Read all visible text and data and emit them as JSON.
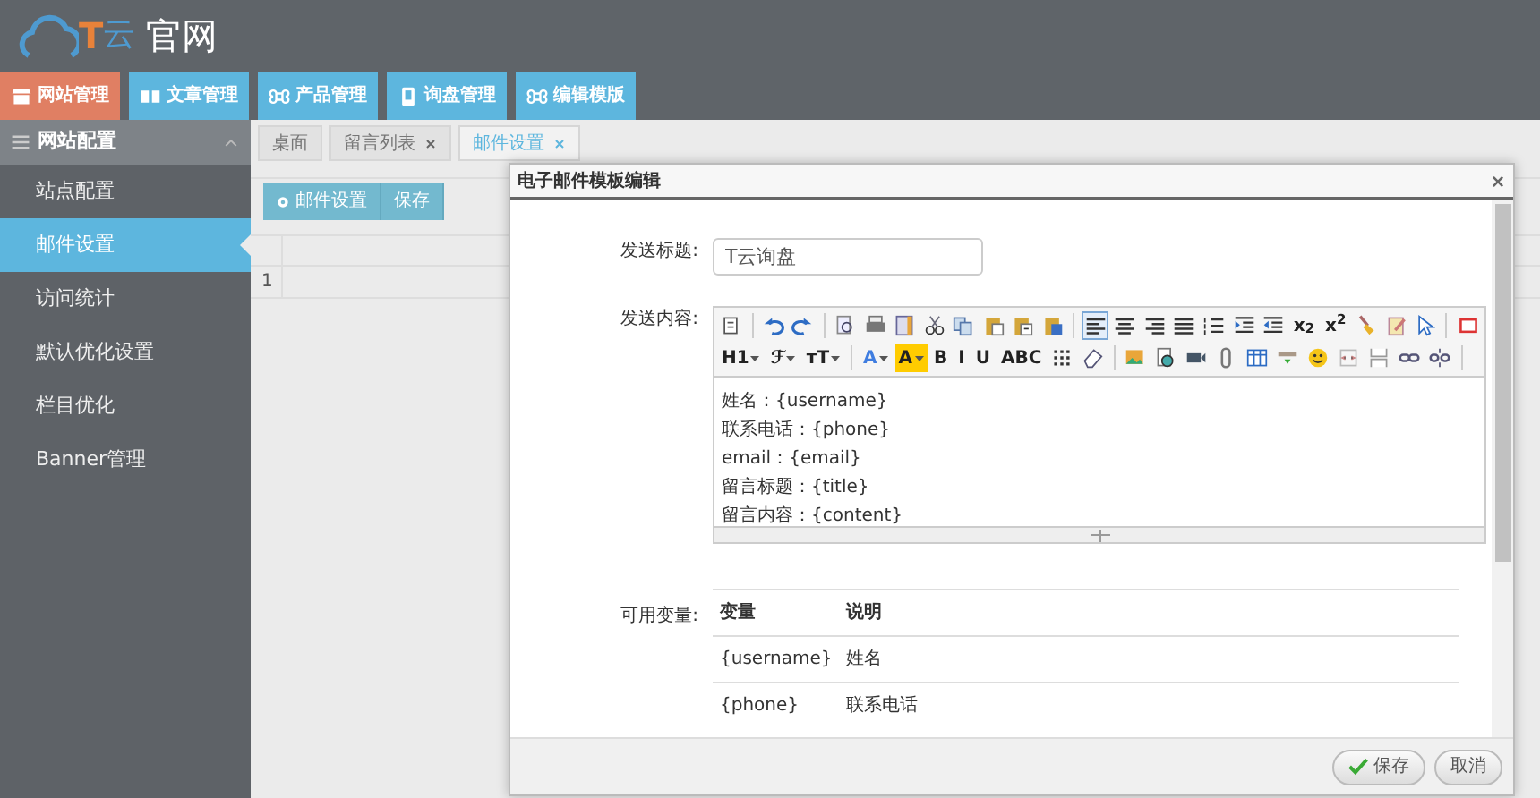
{
  "header": {
    "logo": {
      "mark": "T",
      "name": "云"
    },
    "title": "官网"
  },
  "nav_tabs": [
    {
      "label": "网站管理",
      "selected": true
    },
    {
      "label": "文章管理",
      "selected": false
    },
    {
      "label": "产品管理",
      "selected": false
    },
    {
      "label": "询盘管理",
      "selected": false
    },
    {
      "label": "编辑模版",
      "selected": false
    }
  ],
  "sidebar": {
    "title": "网站配置",
    "expanded": true,
    "items": [
      {
        "label": "站点配置",
        "selected": false
      },
      {
        "label": "邮件设置",
        "selected": true
      },
      {
        "label": "访问统计",
        "selected": false
      },
      {
        "label": "默认优化设置",
        "selected": false
      },
      {
        "label": "栏目优化",
        "selected": false
      },
      {
        "label": "Banner管理",
        "selected": false
      }
    ]
  },
  "page_tabs": [
    {
      "label": "桌面",
      "closable": false,
      "selected": false
    },
    {
      "label": "留言列表",
      "closable": true,
      "selected": false
    },
    {
      "label": "邮件设置",
      "closable": true,
      "selected": true
    }
  ],
  "toolbar": {
    "buttons": [
      "邮件设置",
      "保存"
    ]
  },
  "grid": {
    "rows": [
      {
        "number": "1"
      }
    ]
  },
  "dialog": {
    "title": "电子邮件模板编辑",
    "subject": {
      "label": "发送标题:",
      "value": "T云询盘"
    },
    "content": {
      "label": "发送内容:",
      "align_left_pressed": true,
      "toolbar_labels": [
        {
          "text": "x$_{2}$",
          "kind": "plain"
        },
        {
          "text": "x$^{2}$",
          "kind": "plain"
        },
        {
          "text": "H1",
          "kind": "dropdown"
        },
        {
          "text": "ℱ",
          "kind": "dropdown"
        },
        {
          "text": "ᴛT",
          "kind": "dropdown"
        },
        {
          "text": "A",
          "kind": "color"
        },
        {
          "text": "A",
          "kind": "highlight"
        },
        {
          "text": "B",
          "kind": "plain"
        },
        {
          "text": "I",
          "kind": "plain"
        },
        {
          "text": "U",
          "kind": "plain"
        },
        {
          "text": "ABC",
          "kind": "plain"
        }
      ],
      "lines": [
        "姓名：{username}",
        "联系电话：{phone}",
        "email：{email}",
        "留言标题：{title}",
        "留言内容：{content}"
      ]
    },
    "variables": {
      "label": "可用变量:",
      "columns": [
        "变量",
        "说明"
      ],
      "rows": [
        [
          "{username}",
          "姓名"
        ],
        [
          "{phone}",
          "联系电话"
        ]
      ]
    },
    "buttons": [
      {
        "label": "保存",
        "kind": "confirm"
      },
      {
        "label": "取消",
        "kind": "cancel"
      }
    ]
  }
}
